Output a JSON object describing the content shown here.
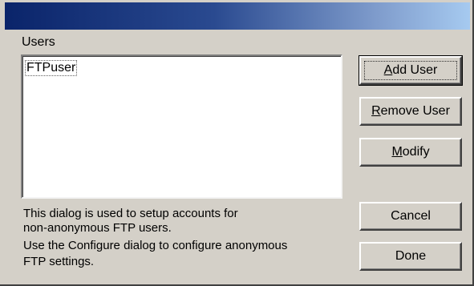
{
  "window": {
    "title": ""
  },
  "users_group": {
    "label": "Users",
    "items": [
      "FTPuser"
    ]
  },
  "buttons": {
    "add_user": {
      "label_mnemonic": "A",
      "label_rest": "dd User"
    },
    "remove_user": {
      "label_mnemonic": "R",
      "label_rest": "emove User"
    },
    "modify": {
      "label_mnemonic": "M",
      "label_rest": "odify"
    },
    "cancel": {
      "label": "Cancel"
    },
    "done": {
      "label": "Done"
    }
  },
  "info_text": {
    "line1": "This dialog is used to setup accounts for",
    "line2": "non-anonymous FTP users.",
    "line3": "Use the Configure dialog to configure anonymous",
    "line4": "FTP settings."
  },
  "colors": {
    "face": "#d4d0c8",
    "title_gradient_start": "#0a246a",
    "title_gradient_end": "#a6caf0"
  }
}
